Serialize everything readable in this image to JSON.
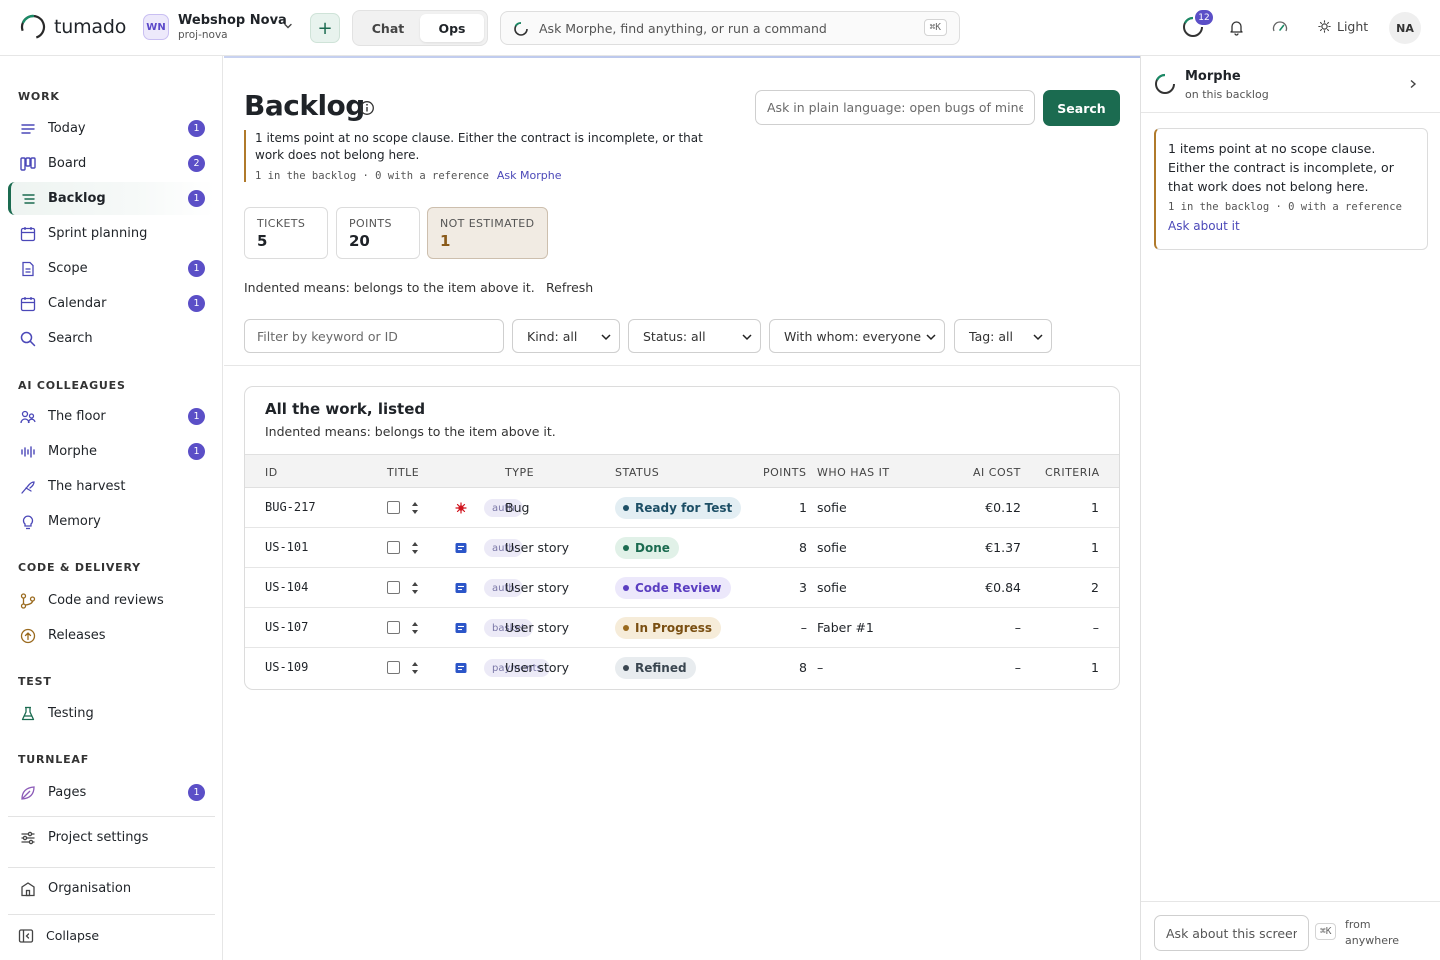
{
  "app": {
    "brand": "tumado",
    "project": {
      "initials": "WN",
      "name": "Webshop Nova",
      "slug": "proj-nova"
    },
    "mode_tabs": [
      {
        "label": "Chat",
        "active": false
      },
      {
        "label": "Ops",
        "active": true
      }
    ],
    "command_placeholder": "Ask Morphe, find anything, or run a command",
    "command_shortcut": "⌘K",
    "activity_count": "12",
    "theme_label": "Light",
    "user_initials": "NA",
    "accent_color": "#1b6b50",
    "badge_color": "#5b4fc7"
  },
  "sidebar": {
    "sections": {
      "work": "WORK",
      "ai": "AI COLLEAGUES",
      "code": "CODE & DELIVERY",
      "test": "TEST",
      "turnleaf": "TURNLEAF"
    },
    "items": {
      "today": {
        "label": "Today",
        "count": "1",
        "icon": "today-icon"
      },
      "board": {
        "label": "Board",
        "count": "2",
        "icon": "board-icon"
      },
      "backlog": {
        "label": "Backlog",
        "count": "1",
        "icon": "list-icon",
        "active": true
      },
      "sprint": {
        "label": "Sprint planning",
        "icon": "calendar-icon"
      },
      "scope": {
        "label": "Scope",
        "count": "1",
        "icon": "document-icon"
      },
      "calendar": {
        "label": "Calendar",
        "count": "1",
        "icon": "calendar-icon"
      },
      "search": {
        "label": "Search",
        "icon": "search-icon"
      },
      "floor": {
        "label": "The floor",
        "count": "1",
        "icon": "people-icon"
      },
      "morphe": {
        "label": "Morphe",
        "count": "1",
        "icon": "waveform-icon"
      },
      "harvest": {
        "label": "The harvest",
        "icon": "harvest-icon"
      },
      "memory": {
        "label": "Memory",
        "icon": "lightbulb-icon"
      },
      "code_reviews": {
        "label": "Code and reviews",
        "icon": "git-branch-icon"
      },
      "releases": {
        "label": "Releases",
        "icon": "upload-circle-icon"
      },
      "testing": {
        "label": "Testing",
        "icon": "flask-icon"
      },
      "pages": {
        "label": "Pages",
        "count": "1",
        "icon": "leaf-icon"
      },
      "settings": {
        "label": "Project settings",
        "icon": "sliders-icon"
      },
      "organisation": {
        "label": "Organisation",
        "icon": "building-icon"
      },
      "collapse": {
        "label": "Collapse",
        "icon": "collapse-icon"
      }
    }
  },
  "main": {
    "title": "Backlog",
    "ask_placeholder": "Ask in plain language: open bugs of mine",
    "search_label": "Search",
    "notice": {
      "text": "1 items point at no scope clause. Either the contract is incomplete, or that work does not belong here.",
      "meta": "1 in the backlog · 0 with a reference",
      "link": "Ask Morphe"
    },
    "stats": [
      {
        "label": "TICKETS",
        "value": "5"
      },
      {
        "label": "POINTS",
        "value": "20"
      },
      {
        "label": "NOT ESTIMATED",
        "value": "1"
      }
    ],
    "hint": "Indented means: belongs to the item above it.",
    "refresh_label": "Refresh",
    "filter_placeholder": "Filter by keyword or ID",
    "selects": {
      "kind": "Kind: all",
      "status": "Status: all",
      "who": "With whom: everyone",
      "tag": "Tag: all"
    },
    "card": {
      "title": "All the work, listed",
      "subtitle": "Indented means: belongs to the item above it."
    },
    "columns": {
      "id": "ID",
      "title": "TITLE",
      "type": "TYPE",
      "status": "STATUS",
      "points": "POINTS",
      "who": "WHO HAS IT",
      "cost": "AI COST",
      "criteria": "CRITERIA"
    },
    "rows": [
      {
        "id": "BUG-217",
        "kind_icon": "bug-icon",
        "tag": "auth",
        "type": "Bug",
        "status": "Ready for Test",
        "status_tone": "teal",
        "points": "1",
        "who": "sofie",
        "cost": "€0.12",
        "criteria": "1"
      },
      {
        "id": "US-101",
        "kind_icon": "story-icon",
        "tag": "auth",
        "type": "User story",
        "status": "Done",
        "status_tone": "green",
        "points": "8",
        "who": "sofie",
        "cost": "€1.37",
        "criteria": "1"
      },
      {
        "id": "US-104",
        "kind_icon": "story-icon",
        "tag": "auth",
        "type": "User story",
        "status": "Code Review",
        "status_tone": "purple",
        "points": "3",
        "who": "sofie",
        "cost": "€0.84",
        "criteria": "2"
      },
      {
        "id": "US-107",
        "kind_icon": "story-icon",
        "tag": "basket",
        "type": "User story",
        "status": "In Progress",
        "status_tone": "amber",
        "points": "–",
        "who": "Faber #1",
        "cost": "–",
        "criteria": "–"
      },
      {
        "id": "US-109",
        "kind_icon": "story-icon",
        "tag": "payments",
        "type": "User story",
        "status": "Refined",
        "status_tone": "slate",
        "points": "8",
        "who": "–",
        "cost": "–",
        "criteria": "1"
      }
    ]
  },
  "panel": {
    "title": "Morphe",
    "subtitle": "on this backlog",
    "card_text": "1 items point at no scope clause. Either the contract is incomplete, or that work does not belong here.",
    "card_meta": "1 in the backlog · 0 with a reference",
    "card_link": "Ask about it",
    "ask_placeholder": "Ask about this screen...",
    "shortcut": "⌘K",
    "from_text": "from anywhere"
  }
}
